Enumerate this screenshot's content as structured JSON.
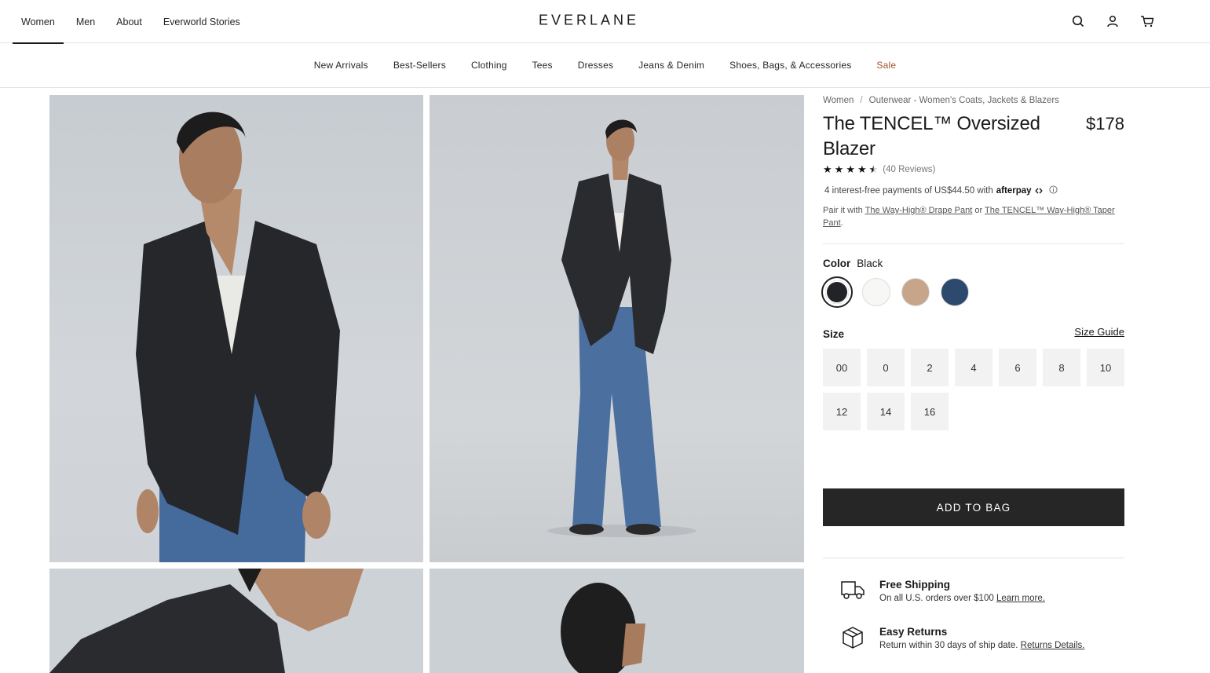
{
  "topnav": {
    "items": [
      {
        "label": "Women",
        "active": true
      },
      {
        "label": "Men"
      },
      {
        "label": "About"
      },
      {
        "label": "Everworld Stories"
      }
    ]
  },
  "brand": "EVERLANE",
  "header_icons": [
    "search-icon",
    "account-icon",
    "cart-icon"
  ],
  "categories": [
    "New Arrivals",
    "Best-Sellers",
    "Clothing",
    "Tees",
    "Dresses",
    "Jeans & Denim",
    "Shoes, Bags, & Accessories",
    "Sale"
  ],
  "breadcrumb": {
    "items": [
      "Women",
      "Outerwear - Women's Coats, Jackets & Blazers"
    ],
    "separator": "/"
  },
  "product": {
    "title": "The TENCEL™ Oversized Blazer",
    "price": "$178",
    "rating": 4.5,
    "reviews": "(40 Reviews)",
    "afterpay_text": "4 interest-free payments of US$44.50 with",
    "afterpay_brand": "afterpay",
    "pair_prefix": "Pair it with",
    "pair_link1": "The Way-High® Drape Pant",
    "pair_or": "or",
    "pair_link2": "The TENCEL™ Way-High® Taper Pant",
    "pair_end": "."
  },
  "color": {
    "label": "Color",
    "selected": "Black",
    "swatches": [
      "#222326",
      "#f7f7f5",
      "#c6a58a",
      "#2d4a6e"
    ]
  },
  "size": {
    "label": "Size",
    "guide": "Size Guide",
    "options": [
      "00",
      "0",
      "2",
      "4",
      "6",
      "8",
      "10",
      "12",
      "14",
      "16"
    ]
  },
  "add_to_bag": "ADD TO BAG",
  "perks": {
    "shipping_title": "Free Shipping",
    "shipping_sub": "On all U.S. orders over $100",
    "shipping_link": "Learn more.",
    "returns_title": "Easy Returns",
    "returns_sub": "Return within 30 days of ship date.",
    "returns_link": "Returns Details."
  }
}
